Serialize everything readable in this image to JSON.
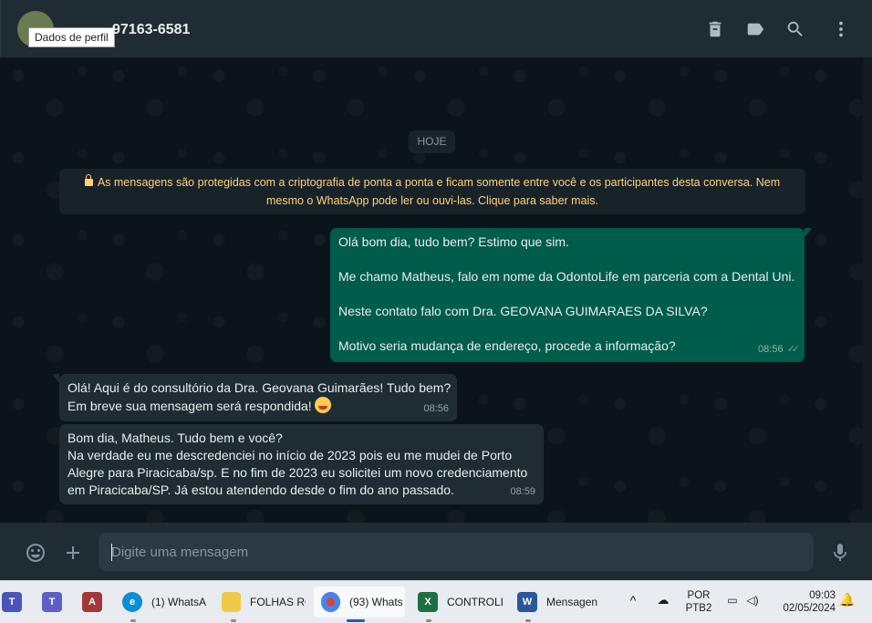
{
  "header": {
    "contact_name": "97163-6581",
    "tooltip": "Dados de perfil",
    "icons": [
      "delete-chat-icon",
      "label-icon",
      "search-icon",
      "menu-icon"
    ]
  },
  "chat": {
    "date_chip": "HOJE",
    "encryption_notice": "As mensagens são protegidas com a criptografia de ponta a ponta e ficam somente entre você e os participantes desta conversa. Nem mesmo o WhatsApp pode ler ou ouvi-las. Clique para saber mais.",
    "encryption_line1": "As mensagens são protegidas com a criptografia de ponta a ponta e ficam somente entre você e os participantes desta conversa. Nem",
    "encryption_line2": "mesmo o WhatsApp pode ler ou ouvi-las. Clique para saber mais.",
    "messages": [
      {
        "direction": "outgoing",
        "lines": [
          "Olá bom dia, tudo bem? Estimo que sim.",
          "",
          "Me chamo Matheus, falo em nome da OdontoLife em parceria com a Dental Uni.",
          "",
          "Neste contato falo com Dra. GEOVANA GUIMARAES DA SILVA?",
          "",
          "Motivo seria mudança de endereço, procede a informação?"
        ],
        "time": "08:56",
        "status": "read"
      },
      {
        "direction": "incoming",
        "lines": [
          "Olá! Aqui é do consultório da Dra. Geovana Guimarães! Tudo bem?",
          "Em breve sua mensagem será respondida!"
        ],
        "emoji": "smiling-face-with-hearts",
        "time": "08:56"
      },
      {
        "direction": "incoming",
        "lines": [
          "Bom dia, Matheus. Tudo bem e você?",
          "Na verdade eu me descredenciei no início de 2023 pois eu me mudei de Porto",
          "Alegre para Piracicaba/sp. E no fim de 2023 eu solicitei um novo credenciamento",
          "em Piracicaba/SP. Já estou atendendo desde o fim do ano passado."
        ],
        "time": "08:59"
      }
    ]
  },
  "composer": {
    "placeholder": "Digite uma mensagem",
    "value": ""
  },
  "taskbar": {
    "apps": [
      {
        "label": "",
        "icon": "teams-icon",
        "color": "#4b53bc"
      },
      {
        "label": "",
        "icon": "teams-new-icon",
        "color": "#5b5fc7"
      },
      {
        "label": "",
        "icon": "access-icon",
        "color": "#a4373a"
      },
      {
        "label": "(1) WhatsA",
        "icon": "edge-icon",
        "color": "#0c8dd6"
      },
      {
        "label": "FOLHAS RC",
        "icon": "folder-icon",
        "color": "#f2c84b"
      },
      {
        "label": "(93) Whats",
        "icon": "chrome-icon",
        "color": "#db4437"
      },
      {
        "label": "CONTROLI",
        "icon": "excel-icon",
        "color": "#1d6f42"
      },
      {
        "label": "Mensagen",
        "icon": "word-icon",
        "color": "#2b579a"
      }
    ],
    "language_line1": "POR",
    "language_line2": "PTB2",
    "time": "09:03",
    "date": "02/05/2024"
  }
}
